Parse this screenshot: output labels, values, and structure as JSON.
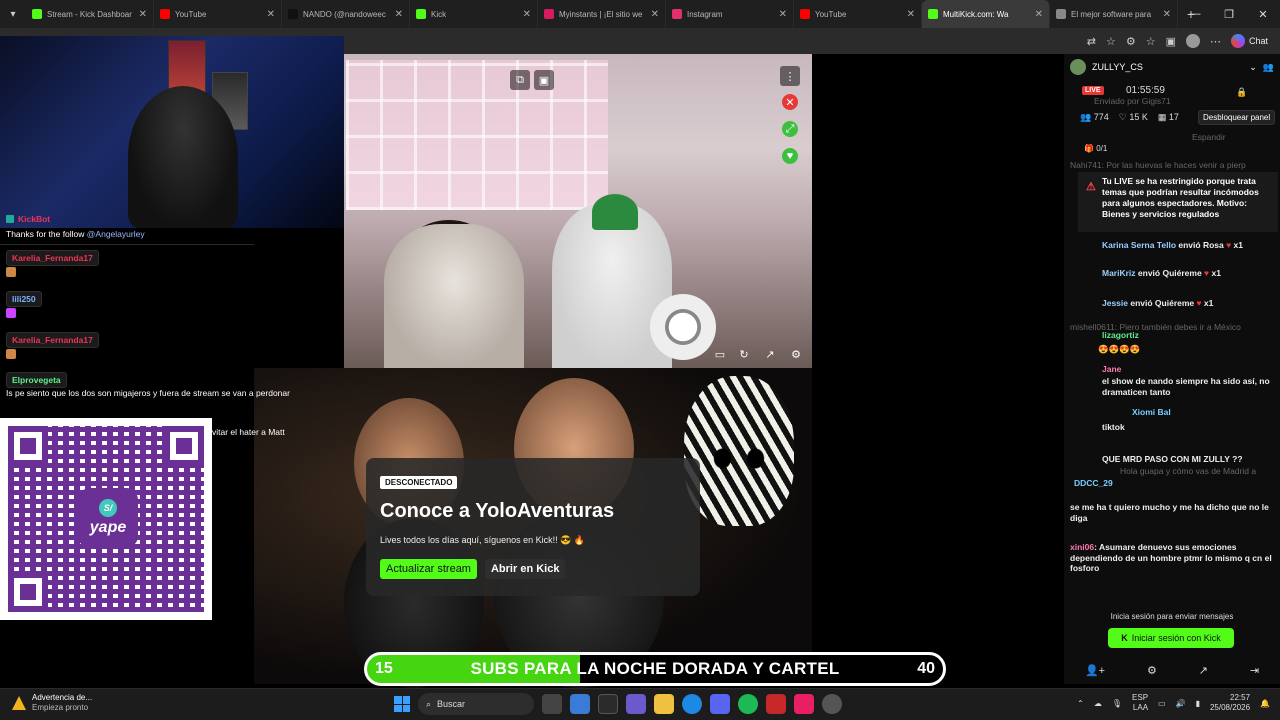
{
  "browser": {
    "tabs": [
      {
        "label": "Stream - Kick Dashboar",
        "color": "#53fc18"
      },
      {
        "label": "YouTube",
        "color": "#ff0000"
      },
      {
        "label": "NANDO (@nandoweec",
        "color": "#111111"
      },
      {
        "label": "Kick",
        "color": "#53fc18"
      },
      {
        "label": "Myinstants | ¡El sitio we",
        "color": "#d81b60"
      },
      {
        "label": "Instagram",
        "color": "#e1306c"
      },
      {
        "label": "YouTube",
        "color": "#ff0000"
      },
      {
        "label": "MultiKick.com: Wa",
        "color": "#53fc18"
      },
      {
        "label": "El mejor software para",
        "color": "#888888"
      }
    ],
    "chat_label": "Chat"
  },
  "left_chat": {
    "kickbot_name": "KickBot",
    "kickbot_msg": "Thanks for the follow ",
    "kickbot_mention": "@Angelayurley",
    "user1": "Karelia_Fernanda17",
    "user2": "lili250",
    "user3": "Karelia_Fernanda17",
    "user4": "Elprovegeta",
    "user4_msg": "Is pe siento que los dos son migajeros y fuera de stream se van a perdonar",
    "partial_msg": "vitar el hater a Matt"
  },
  "qr": {
    "brand": "yape",
    "badge": "S/"
  },
  "player": {
    "card_badge": "DESCONECTADO",
    "card_title": "Conoce a YoloAventuras",
    "card_sub": "Lives todos los días aquí, síguenos en Kick!! 😎 🔥",
    "btn_refresh": "Actualizar stream",
    "btn_open": "Abrir en Kick"
  },
  "subs_goal": {
    "current": "15",
    "label": "SUBS PARA LA NOCHE DORADA Y CARTEL",
    "target": "40",
    "progress": 0.37
  },
  "right_chat": {
    "channel": "ZULLYY_CS",
    "live": "LIVE",
    "timer": "01:55:59",
    "viewers": "774",
    "followers": "15 K",
    "days": "17",
    "unlock": "Desbloquear panel",
    "goal": "0/1",
    "warning": "Tu LIVE se ha restringido porque trata temas que podrían resultar incómodos para algunos espectadores. Motivo: Bienes y servicios regulados",
    "gifts": [
      {
        "user": "Karina Serna Tello",
        "text": " envió Rosa ",
        "count": "x1"
      },
      {
        "user": "MariKriz",
        "text": " envió Quiéreme ",
        "count": "x1"
      },
      {
        "user": "Jessie",
        "text": " envió Quiéreme ",
        "count": "x1"
      }
    ],
    "m_liz": "lizagortiz",
    "m_jane": "Jane",
    "m_jane_msg": "el show de nando siempre ha sido así, no dramaticen tanto",
    "m_xiomi": "Xiomi Bal",
    "m_tiktok": "tiktok",
    "m_zully": "QUE MRD PASO CON MI ZULLY ??",
    "m_ddcc": "DDCC_29",
    "m_ddcc_msg": "Hola guapa y cómo vas de Madrid a",
    "m_quiero": "se me ha t quiero mucho y me ha dicho que no le diga",
    "m_xini": "xini06",
    "m_xini_msg": ": Asumare denuevo sus emociones dependiendo de un hombre ptmr",
    "m_xini_tail": "lo mismo q cn el fosforo",
    "ghost1": "Nahi741: Por las huevas le haces venir a pierp",
    "ghost2": "mishell0611: Piero también debes ir a México",
    "ghost3": "Espandir",
    "ghost4": "Enviado por Gigis71",
    "login_prompt": "Inicia sesión para enviar mensajes",
    "login_btn": "Iniciar sesión con Kick"
  },
  "taskbar": {
    "notice_title": "Advertencia de...",
    "notice_sub": "Empieza pronto",
    "search": "Buscar",
    "lang1": "ESP",
    "lang2": "LAA",
    "time": "22:57",
    "date": "25/08/2026"
  }
}
